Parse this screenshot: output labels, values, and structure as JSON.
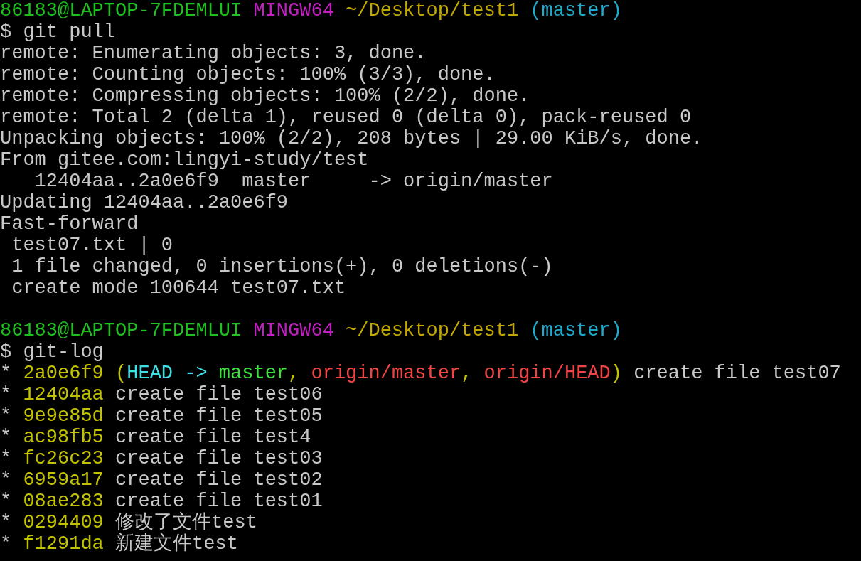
{
  "terminal": {
    "lines": [
      {
        "kind": "prompt",
        "segments": [
          {
            "kind": "user",
            "text": "86183@LAPTOP-7FDEMLUI"
          },
          {
            "kind": "system",
            "text": "MINGW64"
          },
          {
            "kind": "path",
            "text": "~/Desktop/test1"
          },
          {
            "kind": "branch",
            "text": "(master)"
          }
        ]
      },
      {
        "kind": "text",
        "segments": [
          {
            "kind": "plain",
            "text": "$ git pull"
          }
        ]
      },
      {
        "kind": "text",
        "segments": [
          {
            "kind": "plain",
            "text": "remote: Enumerating objects: 3, done."
          }
        ]
      },
      {
        "kind": "text",
        "segments": [
          {
            "kind": "plain",
            "text": "remote: Counting objects: 100% (3/3), done."
          }
        ]
      },
      {
        "kind": "text",
        "segments": [
          {
            "kind": "plain",
            "text": "remote: Compressing objects: 100% (2/2), done."
          }
        ]
      },
      {
        "kind": "text",
        "segments": [
          {
            "kind": "plain",
            "text": "remote: Total 2 (delta 1), reused 0 (delta 0), pack-reused 0"
          }
        ]
      },
      {
        "kind": "text",
        "segments": [
          {
            "kind": "plain",
            "text": "Unpacking objects: 100% (2/2), 208 bytes | 29.00 KiB/s, done."
          }
        ]
      },
      {
        "kind": "text",
        "segments": [
          {
            "kind": "plain",
            "text": "From gitee.com:lingyi-study/test"
          }
        ]
      },
      {
        "kind": "text",
        "segments": [
          {
            "kind": "plain",
            "text": "   12404aa..2a0e6f9  master     -> origin/master"
          }
        ]
      },
      {
        "kind": "text",
        "segments": [
          {
            "kind": "plain",
            "text": "Updating 12404aa..2a0e6f9"
          }
        ]
      },
      {
        "kind": "text",
        "segments": [
          {
            "kind": "plain",
            "text": "Fast-forward"
          }
        ]
      },
      {
        "kind": "text",
        "segments": [
          {
            "kind": "plain",
            "text": " test07.txt | 0"
          }
        ]
      },
      {
        "kind": "text",
        "segments": [
          {
            "kind": "plain",
            "text": " 1 file changed, 0 insertions(+), 0 deletions(-)"
          }
        ]
      },
      {
        "kind": "text",
        "segments": [
          {
            "kind": "plain",
            "text": " create mode 100644 test07.txt"
          }
        ]
      },
      {
        "kind": "blank"
      },
      {
        "kind": "prompt",
        "segments": [
          {
            "kind": "user",
            "text": "86183@LAPTOP-7FDEMLUI"
          },
          {
            "kind": "system",
            "text": "MINGW64"
          },
          {
            "kind": "path",
            "text": "~/Desktop/test1"
          },
          {
            "kind": "branch",
            "text": "(master)"
          }
        ]
      },
      {
        "kind": "text",
        "segments": [
          {
            "kind": "plain",
            "text": "$ git-log"
          }
        ]
      },
      {
        "kind": "text",
        "segments": [
          {
            "kind": "plain",
            "text": "* "
          },
          {
            "kind": "hash",
            "text": "2a0e6f9 ("
          },
          {
            "kind": "head",
            "text": "HEAD -> "
          },
          {
            "kind": "local",
            "text": "master"
          },
          {
            "kind": "hash",
            "text": ", "
          },
          {
            "kind": "remote",
            "text": "origin/master"
          },
          {
            "kind": "hash",
            "text": ", "
          },
          {
            "kind": "remote",
            "text": "origin/HEAD"
          },
          {
            "kind": "hash",
            "text": ")"
          },
          {
            "kind": "plain",
            "text": " create file test07"
          }
        ]
      },
      {
        "kind": "text",
        "segments": [
          {
            "kind": "plain",
            "text": "* "
          },
          {
            "kind": "hash",
            "text": "12404aa"
          },
          {
            "kind": "plain",
            "text": " create file test06"
          }
        ]
      },
      {
        "kind": "text",
        "segments": [
          {
            "kind": "plain",
            "text": "* "
          },
          {
            "kind": "hash",
            "text": "9e9e85d"
          },
          {
            "kind": "plain",
            "text": " create file test05"
          }
        ]
      },
      {
        "kind": "text",
        "segments": [
          {
            "kind": "plain",
            "text": "* "
          },
          {
            "kind": "hash",
            "text": "ac98fb5"
          },
          {
            "kind": "plain",
            "text": " create file test4"
          }
        ]
      },
      {
        "kind": "text",
        "segments": [
          {
            "kind": "plain",
            "text": "* "
          },
          {
            "kind": "hash",
            "text": "fc26c23"
          },
          {
            "kind": "plain",
            "text": " create file test03"
          }
        ]
      },
      {
        "kind": "text",
        "segments": [
          {
            "kind": "plain",
            "text": "* "
          },
          {
            "kind": "hash",
            "text": "6959a17"
          },
          {
            "kind": "plain",
            "text": " create file test02"
          }
        ]
      },
      {
        "kind": "text",
        "segments": [
          {
            "kind": "plain",
            "text": "* "
          },
          {
            "kind": "hash",
            "text": "08ae283"
          },
          {
            "kind": "plain",
            "text": " create file test01"
          }
        ]
      },
      {
        "kind": "text",
        "segments": [
          {
            "kind": "plain",
            "text": "* "
          },
          {
            "kind": "hash",
            "text": "0294409"
          },
          {
            "kind": "plain",
            "text": " 修改了文件test"
          }
        ]
      },
      {
        "kind": "text",
        "segments": [
          {
            "kind": "plain",
            "text": "* "
          },
          {
            "kind": "hash",
            "text": "f1291da"
          },
          {
            "kind": "plain",
            "text": " 新建文件test"
          }
        ]
      }
    ]
  }
}
